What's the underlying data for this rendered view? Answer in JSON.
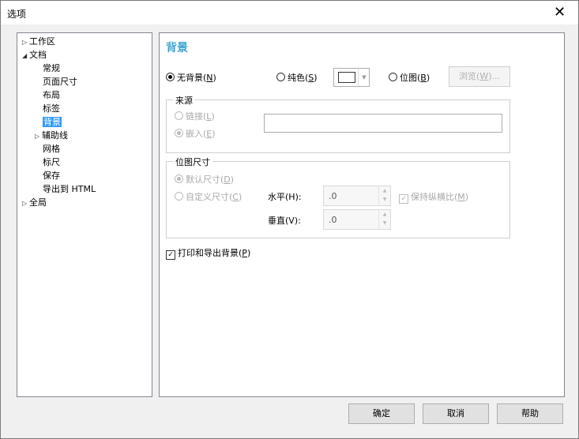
{
  "window": {
    "title": "选项",
    "close_glyph": "✕"
  },
  "tree": {
    "items": [
      {
        "label": "工作区",
        "arrow": "▷"
      },
      {
        "label": "文档",
        "arrow": "◢"
      },
      {
        "label": "常规"
      },
      {
        "label": "页面尺寸"
      },
      {
        "label": "布局"
      },
      {
        "label": "标签"
      },
      {
        "label": "背景"
      },
      {
        "label": "辅助线",
        "arrow": "▷"
      },
      {
        "label": "网格"
      },
      {
        "label": "标尺"
      },
      {
        "label": "保存"
      },
      {
        "label": "导出到 HTML"
      },
      {
        "label": "全局",
        "arrow": "▷"
      }
    ],
    "selected": "背景"
  },
  "panel": {
    "heading": "背景",
    "heading_color": "#3fa6d2",
    "no_bg": {
      "label": "无背景(",
      "key": "N",
      "tail": ")"
    },
    "solid": {
      "label": "纯色(",
      "key": "S",
      "tail": ")"
    },
    "bitmap": {
      "label": "位图(",
      "key": "B",
      "tail": ")"
    },
    "browse": {
      "label": "浏览(",
      "key": "W",
      "tail": ")..."
    },
    "source": {
      "legend": "来源",
      "link": {
        "label": "链接(",
        "key": "L",
        "tail": ")"
      },
      "embed": {
        "label": "嵌入(",
        "key": "E",
        "tail": ")"
      },
      "path_value": ""
    },
    "bitmap_size": {
      "legend": "位图尺寸",
      "default_size": {
        "label": "默认尺寸(",
        "key": "D",
        "tail": ")"
      },
      "custom_size": {
        "label": "自定义尺寸(",
        "key": "C",
        "tail": ")"
      },
      "horizontal_label": "水平(H):",
      "vertical_label": "垂直(V):",
      "horizontal_value": ".0",
      "vertical_value": ".0",
      "keep_ratio": {
        "label": "保持纵横比(",
        "key": "M",
        "tail": ")"
      }
    },
    "print_export": {
      "label": "打印和导出背景(",
      "key": "P",
      "tail": ")"
    }
  },
  "footer": {
    "ok": "确定",
    "cancel": "取消",
    "help": "帮助"
  }
}
